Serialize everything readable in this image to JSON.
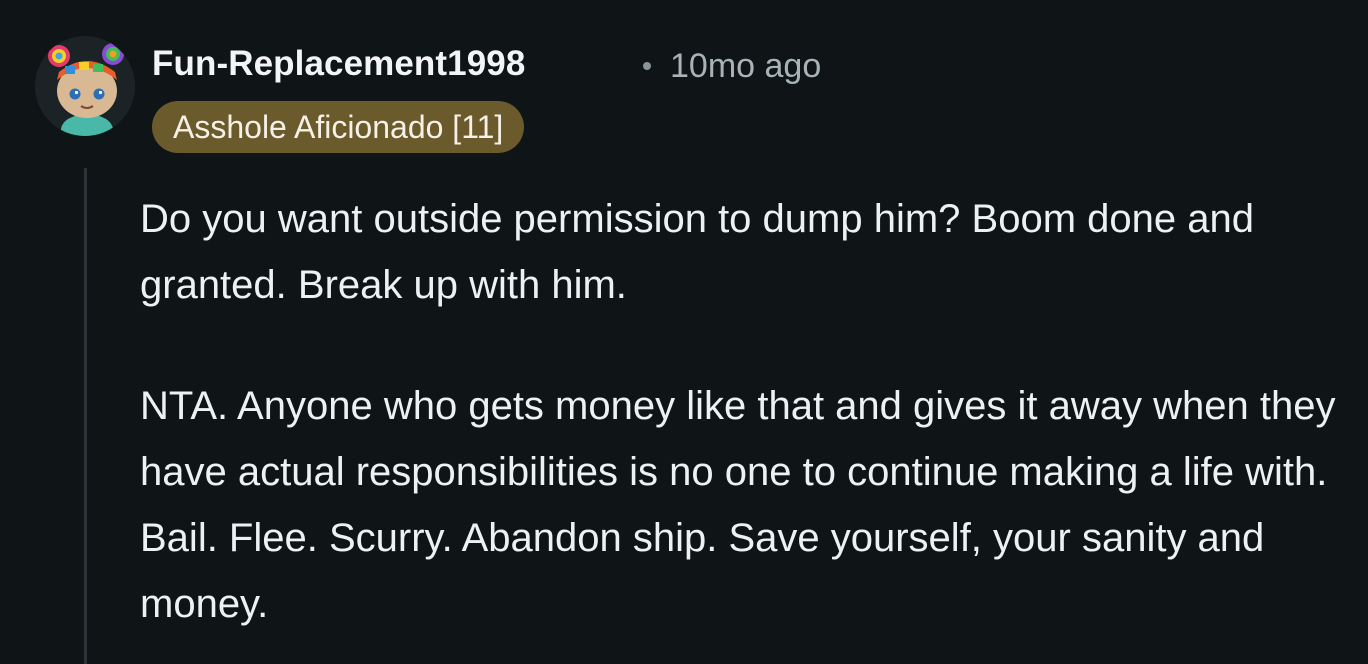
{
  "comment": {
    "username": "Fun-Replacement1998",
    "separator": "•",
    "timestamp": "10mo ago",
    "flair": "Asshole Aficionado [11]",
    "avatar_icon": "snoo-avatar-icon",
    "paragraphs": [
      "Do you want outside permission to dump him? Boom done and granted. Break up with him.",
      "NTA. Anyone who gets money like that and gives it away when they have actual responsibilities is no one to continue making a life with. Bail. Flee. Scurry. Abandon ship. Save yourself, your sanity and money."
    ]
  },
  "colors": {
    "background": "#0f1416",
    "flair_background": "#6b5a2c",
    "thread_line": "#2c3438",
    "text": "#eef1f3",
    "muted_text": "#a8b3b8"
  }
}
